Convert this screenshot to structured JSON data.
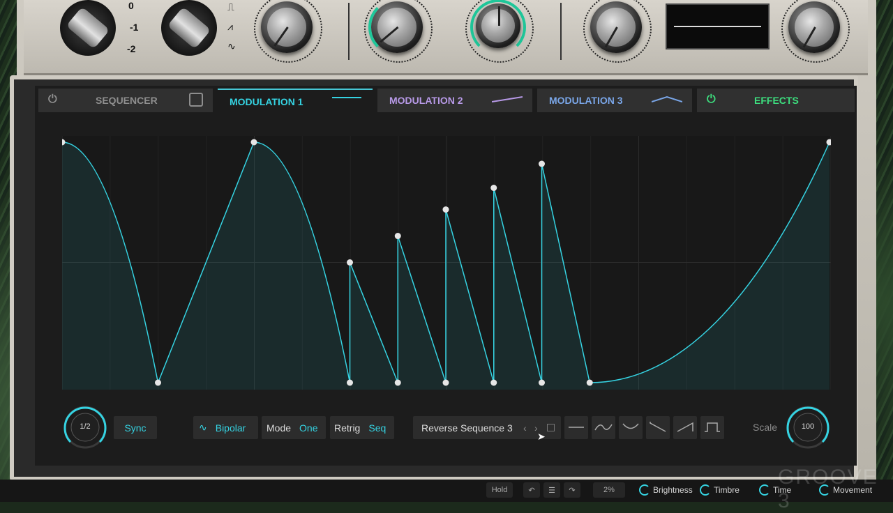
{
  "switch_labels": {
    "zero": "0",
    "minus1": "-1",
    "minus2": "-2"
  },
  "tabs": [
    {
      "label": "SEQUENCER",
      "color": "#8e8e8e"
    },
    {
      "label": "MODULATION 1",
      "color": "#35d3e2"
    },
    {
      "label": "MODULATION 2",
      "color": "#b89ae8"
    },
    {
      "label": "MODULATION 3",
      "color": "#7aa6e8"
    },
    {
      "label": "EFFECTS",
      "color": "#3dde7e"
    }
  ],
  "rate": {
    "label": "1/2"
  },
  "sync": {
    "label": "Sync"
  },
  "polarity": {
    "label": "Bipolar"
  },
  "mode": {
    "label": "Mode",
    "value": "One"
  },
  "retrig": {
    "label": "Retrig",
    "value": "Seq"
  },
  "preset": {
    "name": "Reverse Sequence 3"
  },
  "scale": {
    "label": "Scale",
    "value": "100"
  },
  "bottom": {
    "hold": "Hold",
    "percent": "2%",
    "macros": [
      "Brightness",
      "Timbre",
      "Time",
      "Movement"
    ]
  },
  "watermark": "GROOVE 3",
  "colors": {
    "accent": "#35d3e2",
    "effects": "#3dde7e"
  },
  "envelope": {
    "points": [
      [
        0,
        1
      ],
      [
        0.2,
        0
      ],
      [
        0.4,
        1
      ],
      [
        0.6,
        0
      ],
      [
        0.6,
        0.5
      ],
      [
        0.7,
        0
      ],
      [
        0.7,
        0.61
      ],
      [
        0.8,
        0
      ],
      [
        0.8,
        0.72
      ],
      [
        0.9,
        0
      ],
      [
        0.9,
        0.81
      ],
      [
        1.0,
        0
      ],
      [
        1.0,
        0.91
      ],
      [
        1.1,
        0
      ],
      [
        1.6,
        1
      ]
    ]
  }
}
